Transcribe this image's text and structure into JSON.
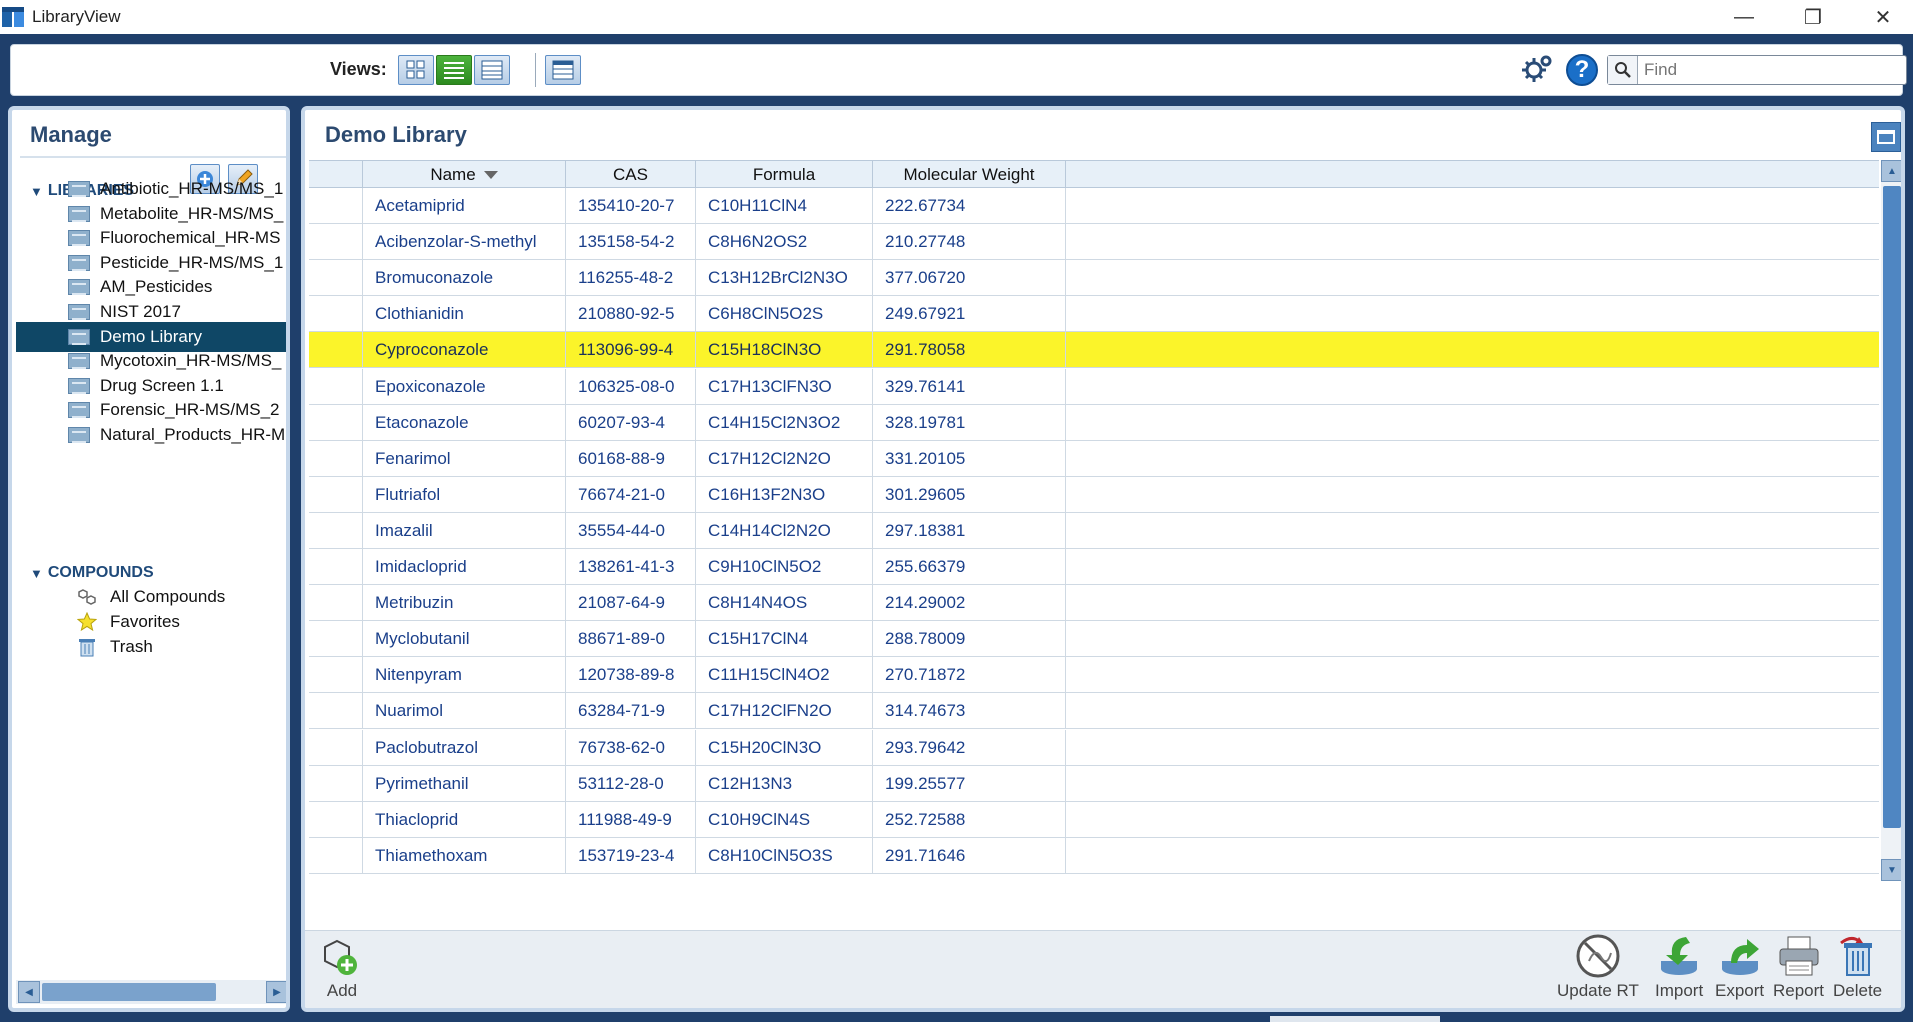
{
  "window": {
    "title": "LibraryView",
    "controls": [
      "—",
      "❐",
      "✕"
    ]
  },
  "toolbar": {
    "views_label": "Views:",
    "search_placeholder": "Find"
  },
  "manage": {
    "title": "Manage",
    "libraries_header": "LIBRARIES",
    "libraries": [
      {
        "label": "Antibiotic_HR-MS/MS_1"
      },
      {
        "label": "Metabolite_HR-MS/MS_"
      },
      {
        "label": "Fluorochemical_HR-MS"
      },
      {
        "label": "Pesticide_HR-MS/MS_1"
      },
      {
        "label": "AM_Pesticides"
      },
      {
        "label": "NIST 2017"
      },
      {
        "label": "Demo Library",
        "selected": true
      },
      {
        "label": "Mycotoxin_HR-MS/MS_"
      },
      {
        "label": "Drug Screen 1.1"
      },
      {
        "label": "Forensic_HR-MS/MS_2"
      },
      {
        "label": "Natural_Products_HR-M"
      }
    ],
    "compounds_header": "COMPOUNDS",
    "compounds": [
      {
        "label": "All Compounds",
        "icon": "molecule-icon"
      },
      {
        "label": "Favorites",
        "icon": "star-icon"
      },
      {
        "label": "Trash",
        "icon": "trash-icon"
      }
    ]
  },
  "library": {
    "title": "Demo Library",
    "columns": [
      "Name",
      "CAS",
      "Formula",
      "Molecular Weight"
    ],
    "rows": [
      {
        "name": "Acetamiprid",
        "cas": "135410-20-7",
        "formula": "C10H11ClN4",
        "mw": "222.67734"
      },
      {
        "name": "Acibenzolar-S-methyl",
        "cas": "135158-54-2",
        "formula": "C8H6N2OS2",
        "mw": "210.27748"
      },
      {
        "name": "Bromuconazole",
        "cas": "116255-48-2",
        "formula": "C13H12BrCl2N3O",
        "mw": "377.06720"
      },
      {
        "name": "Clothianidin",
        "cas": "210880-92-5",
        "formula": "C6H8ClN5O2S",
        "mw": "249.67921"
      },
      {
        "name": "Cyproconazole",
        "cas": "113096-99-4",
        "formula": "C15H18ClN3O",
        "mw": "291.78058",
        "selected": true
      },
      {
        "name": "Epoxiconazole",
        "cas": "106325-08-0",
        "formula": "C17H13ClFN3O",
        "mw": "329.76141"
      },
      {
        "name": "Etaconazole",
        "cas": "60207-93-4",
        "formula": "C14H15Cl2N3O2",
        "mw": "328.19781"
      },
      {
        "name": "Fenarimol",
        "cas": "60168-88-9",
        "formula": "C17H12Cl2N2O",
        "mw": "331.20105"
      },
      {
        "name": "Flutriafol",
        "cas": "76674-21-0",
        "formula": "C16H13F2N3O",
        "mw": "301.29605"
      },
      {
        "name": "Imazalil",
        "cas": "35554-44-0",
        "formula": "C14H14Cl2N2O",
        "mw": "297.18381"
      },
      {
        "name": "Imidacloprid",
        "cas": "138261-41-3",
        "formula": "C9H10ClN5O2",
        "mw": "255.66379"
      },
      {
        "name": "Metribuzin",
        "cas": "21087-64-9",
        "formula": "C8H14N4OS",
        "mw": "214.29002"
      },
      {
        "name": "Myclobutanil",
        "cas": "88671-89-0",
        "formula": "C15H17ClN4",
        "mw": "288.78009"
      },
      {
        "name": "Nitenpyram",
        "cas": "120738-89-8",
        "formula": "C11H15ClN4O2",
        "mw": "270.71872"
      },
      {
        "name": "Nuarimol",
        "cas": "63284-71-9",
        "formula": "C17H12ClFN2O",
        "mw": "314.74673"
      },
      {
        "name": "Paclobutrazol",
        "cas": "76738-62-0",
        "formula": "C15H20ClN3O",
        "mw": "293.79642"
      },
      {
        "name": "Pyrimethanil",
        "cas": "53112-28-0",
        "formula": "C12H13N3",
        "mw": "199.25577"
      },
      {
        "name": "Thiacloprid",
        "cas": "111988-49-9",
        "formula": "C10H9ClN4S",
        "mw": "252.72588"
      },
      {
        "name": "Thiamethoxam",
        "cas": "153719-23-4",
        "formula": "C8H10ClN5O3S",
        "mw": "291.71646"
      }
    ]
  },
  "actions": {
    "add": "Add",
    "update_rt": "Update RT",
    "import": "Import",
    "export": "Export",
    "report": "Report",
    "delete": "Delete"
  },
  "colors": {
    "selected_row": "#fbf42a",
    "selected_library": "#0f4766",
    "link_text": "#1a3f8a",
    "panel_header": "#2c4a70"
  }
}
